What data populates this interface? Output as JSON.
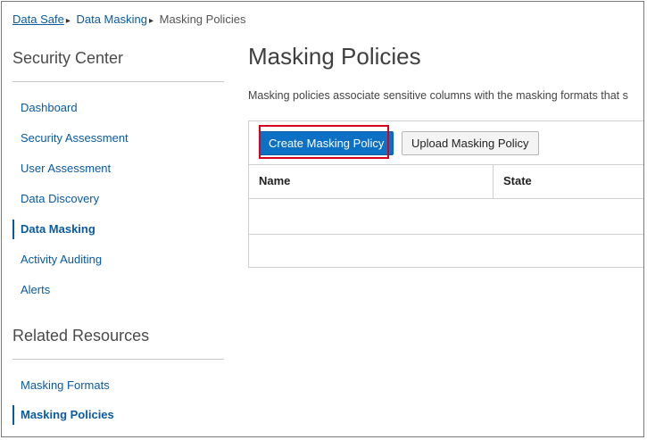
{
  "breadcrumb": {
    "home": "Data Safe",
    "section": "Data Masking",
    "current": "Masking Policies",
    "separator": "▸"
  },
  "sidebar": {
    "security_center_heading": "Security Center",
    "items": [
      {
        "label": "Dashboard",
        "active": false
      },
      {
        "label": "Security Assessment",
        "active": false
      },
      {
        "label": "User Assessment",
        "active": false
      },
      {
        "label": "Data Discovery",
        "active": false
      },
      {
        "label": "Data Masking",
        "active": true
      },
      {
        "label": "Activity Auditing",
        "active": false
      },
      {
        "label": "Alerts",
        "active": false
      }
    ],
    "related_heading": "Related Resources",
    "related_items": [
      {
        "label": "Masking Formats",
        "active": false
      },
      {
        "label": "Masking Policies",
        "active": true
      }
    ]
  },
  "main": {
    "title": "Masking Policies",
    "description": "Masking policies associate sensitive columns with the masking formats that s",
    "toolbar": {
      "create_label": "Create Masking Policy",
      "upload_label": "Upload Masking Policy"
    },
    "table": {
      "columns": [
        "Name",
        "State"
      ],
      "rows": []
    }
  },
  "colors": {
    "link": "#0a5aa0",
    "primary_button": "#0c70c4",
    "highlight": "#d9001b"
  }
}
